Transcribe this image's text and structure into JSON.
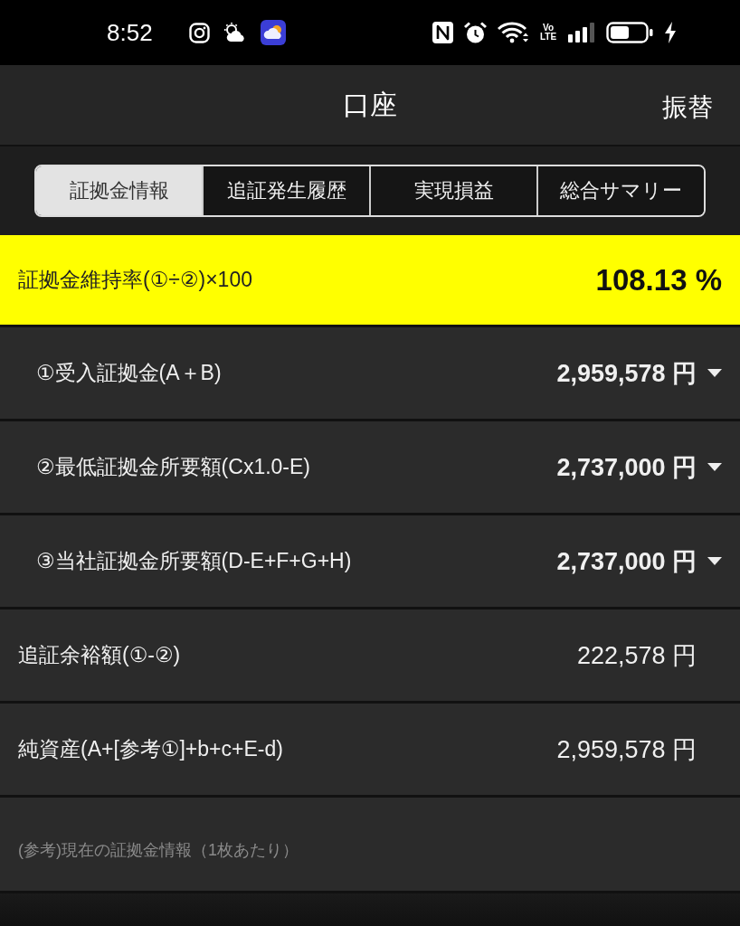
{
  "status_bar": {
    "time": "8:52",
    "network_label": "Vo LTE"
  },
  "header": {
    "title": "口座",
    "action": "振替"
  },
  "tabs": [
    {
      "label": "証拠金情報",
      "selected": true
    },
    {
      "label": "追証発生履歴",
      "selected": false
    },
    {
      "label": "実現損益",
      "selected": false
    },
    {
      "label": "総合サマリー",
      "selected": false
    }
  ],
  "highlight": {
    "label": "証拠金維持率(①÷②)×100",
    "value": "108.13 %"
  },
  "rows": [
    {
      "kind": "expandable",
      "label": "①受入証拠金(A＋B)",
      "value": "2,959,578 円"
    },
    {
      "kind": "expandable",
      "label": "②最低証拠金所要額(Cx1.0-E)",
      "value": "2,737,000 円"
    },
    {
      "kind": "expandable",
      "label": "③当社証拠金所要額(D-E+F+G+H)",
      "value": "2,737,000 円"
    },
    {
      "kind": "plain",
      "label": "追証余裕額(①-②)",
      "value": "222,578 円"
    },
    {
      "kind": "plain",
      "label": "純資産(A+[参考①]+b+c+E-d)",
      "value": "2,959,578 円"
    }
  ],
  "note": "(参考)現在の証拠金情報（1枚あたり）"
}
